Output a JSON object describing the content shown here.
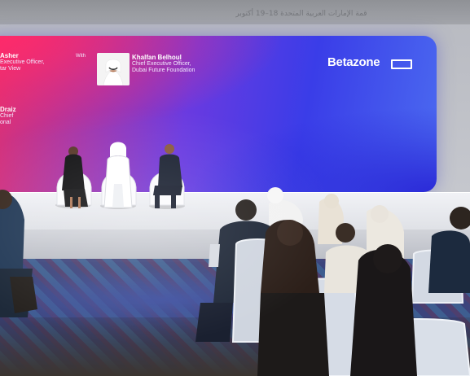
{
  "caption": {
    "arabic_text": "قمة الإمارات العربية المتحدة 18–19 أكتوبر"
  },
  "screen": {
    "left_speaker": {
      "name": "Asher",
      "title_line1": "Executive Officer,",
      "title_line2": "tar View"
    },
    "left_speaker_2": {
      "name": "Draiz",
      "title_line1": "Chief",
      "title_line2": "onal"
    },
    "moderator_tag": "With",
    "right_speaker": {
      "name": "Khalfan Belhoul",
      "title_line1": "Chief Executive Officer,",
      "title_line2": "Dubai Future Foundation"
    },
    "logo_text": "Betazone"
  },
  "colors": {
    "screen_pink": "#e8306a",
    "screen_blue": "#3a3de8",
    "stage_white": "#f1f2f6",
    "carpet_blue": "#38407a"
  }
}
